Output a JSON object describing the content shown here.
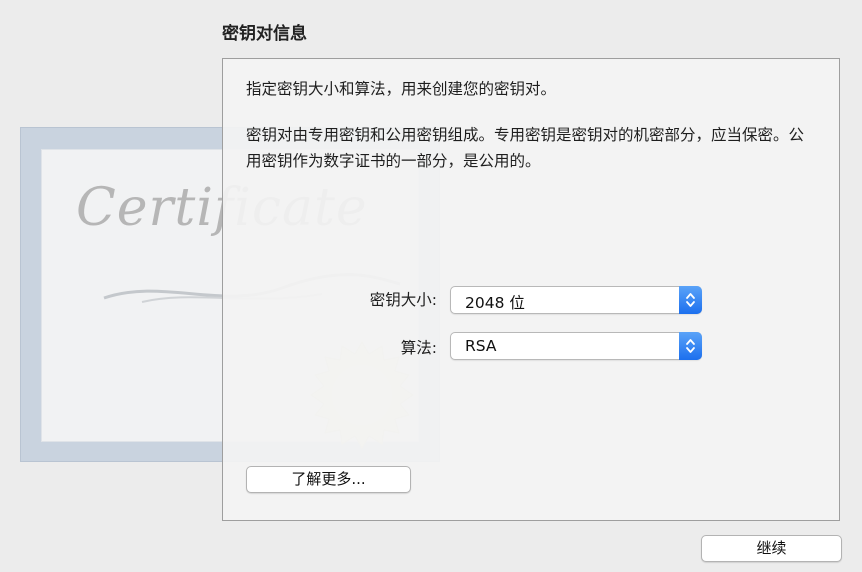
{
  "section": {
    "title": "密钥对信息"
  },
  "panel": {
    "intro": "指定密钥大小和算法，用来创建您的密钥对。",
    "description": "密钥对由专用密钥和公用密钥组成。专用密钥是密钥对的机密部分，应当保密。公用密钥作为数字证书的一部分，是公用的。",
    "key_size": {
      "label": "密钥大小:",
      "value": "2048 位"
    },
    "algorithm": {
      "label": "算法:",
      "value": "RSA"
    },
    "learn_more_label": "了解更多..."
  },
  "decoration": {
    "certificate_text": "Certificate"
  },
  "footer": {
    "continue_label": "继续"
  },
  "colors": {
    "accent": "#2a7cf0",
    "panel_border": "#9e9e9e",
    "background": "#ececec"
  },
  "icons": {
    "stepper": "up-down-chevron-icon",
    "seal": "certificate-seal-icon"
  }
}
